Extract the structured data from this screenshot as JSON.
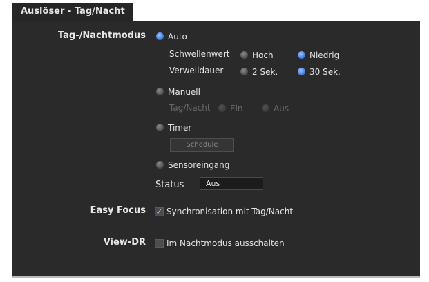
{
  "tab": {
    "title": "Auslöser - Tag/Nacht"
  },
  "day_night": {
    "label": "Tag-/Nachtmodus",
    "auto": {
      "label": "Auto",
      "threshold": {
        "label": "Schwellenwert",
        "options": [
          "Hoch",
          "Niedrig"
        ],
        "selected": "Niedrig"
      },
      "dwell": {
        "label": "Verweildauer",
        "options": [
          "2 Sek.",
          "30 Sek."
        ],
        "selected": "30 Sek."
      }
    },
    "manual": {
      "label": "Manuell",
      "sub_label": "Tag/Nacht",
      "options": [
        "Ein",
        "Aus"
      ]
    },
    "timer": {
      "label": "Timer",
      "schedule_button": "Schedule"
    },
    "sensor": {
      "label": "Sensoreingang"
    },
    "status": {
      "label": "Status",
      "value": "Aus"
    },
    "selected_mode": "Auto"
  },
  "easy_focus": {
    "label": "Easy Focus",
    "checkbox_label": "Synchronisation mit Tag/Nacht",
    "checked": true
  },
  "view_dr": {
    "label": "View-DR",
    "checkbox_label": "Im Nachtmodus ausschalten",
    "checked": false
  },
  "colors": {
    "accent": "#3f79df",
    "panel": "#2a2a2a"
  }
}
